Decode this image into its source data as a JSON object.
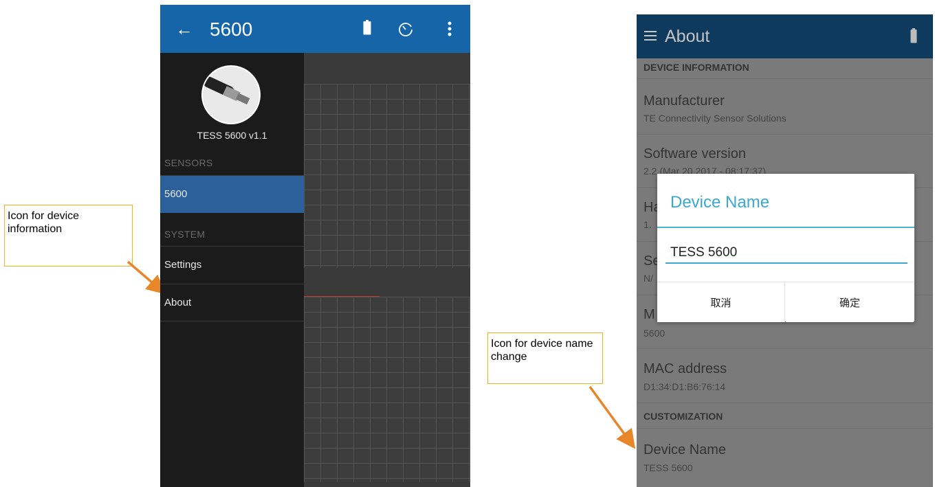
{
  "callouts": {
    "info": "Icon for device information",
    "name_change": "Icon for device name change"
  },
  "left_screen": {
    "toolbar": {
      "back_glyph": "←",
      "title": "5600",
      "icons": [
        "battery-icon",
        "timer-icon",
        "more-vert-icon"
      ]
    },
    "drawer": {
      "device_name": "TESS 5600 v1.1",
      "sensors_section": "SENSORS",
      "sensors_items": [
        {
          "label": "5600",
          "active": true
        }
      ],
      "system_section": "SYSTEM",
      "system_items": [
        {
          "label": "Settings"
        },
        {
          "label": "About"
        }
      ]
    },
    "colors": {
      "appbar": "#1565a8",
      "active_item": "#2c609a",
      "drawer": "#1b1b1b"
    }
  },
  "right_screen": {
    "toolbar": {
      "title": "About",
      "icons": [
        "menu-icon",
        "battery-icon"
      ]
    },
    "device_info_header": "DEVICE INFORMATION",
    "rows": [
      {
        "title": "Manufacturer",
        "value": "TE Connectivity Sensor Solutions"
      },
      {
        "title": "Software version",
        "value": "2.2 (Mar 20 2017 - 08:17:37)"
      },
      {
        "title": "Ha",
        "value": "1."
      },
      {
        "title": "Se",
        "value": "N/"
      },
      {
        "title": "M",
        "value": "5600"
      },
      {
        "title": "MAC address",
        "value": "D1:34:D1:B6:76:14"
      }
    ],
    "customization_header": "CUSTOMIZATION",
    "custom_row": {
      "title": "Device Name",
      "value": "TESS 5600"
    },
    "dialog": {
      "title": "Device Name",
      "input_value": "TESS 5600",
      "cancel_label": "取消",
      "ok_label": "确定"
    },
    "colors": {
      "appbar": "#0e3a5e",
      "dialog_accent": "#3aa8d0"
    }
  }
}
